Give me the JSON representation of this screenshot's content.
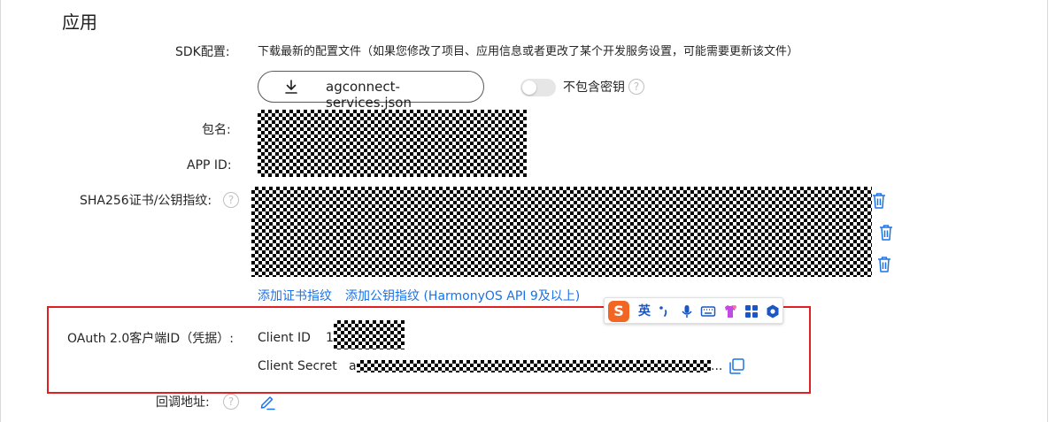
{
  "section": {
    "title": "应用"
  },
  "sdk": {
    "label": "SDK配置:",
    "description": "下载最新的配置文件（如果您修改了项目、应用信息或者更改了某个开发服务设置，可能需要更新该文件）",
    "download_button": "agconnect-services.json",
    "toggle_label": "不包含密钥",
    "toggle_on": false
  },
  "package": {
    "label": "包名:"
  },
  "app_id": {
    "label": "APP ID:"
  },
  "sha256": {
    "label": "SHA256证书/公钥指纹:",
    "add_cert_link": "添加证书指纹",
    "add_pubkey_link": "添加公钥指纹 (HarmonyOS API 9及以上)"
  },
  "oauth": {
    "label": "OAuth 2.0客户端ID（凭据）:",
    "client_id_label": "Client ID",
    "client_id_prefix": "1",
    "client_secret_label": "Client Secret",
    "client_secret_prefix": "a",
    "client_secret_suffix": "..."
  },
  "callback": {
    "label": "回调地址:"
  },
  "ime_toolbar": {
    "logo": "S",
    "mode": "英",
    "icons": [
      "punctuation-icon",
      "microphone-icon",
      "keyboard-icon",
      "skin-icon",
      "toolbox-icon",
      "settings-icon"
    ]
  },
  "colors": {
    "link": "#1a73e8",
    "highlight_box": "#e02020",
    "ime_logo": "#f26522"
  }
}
